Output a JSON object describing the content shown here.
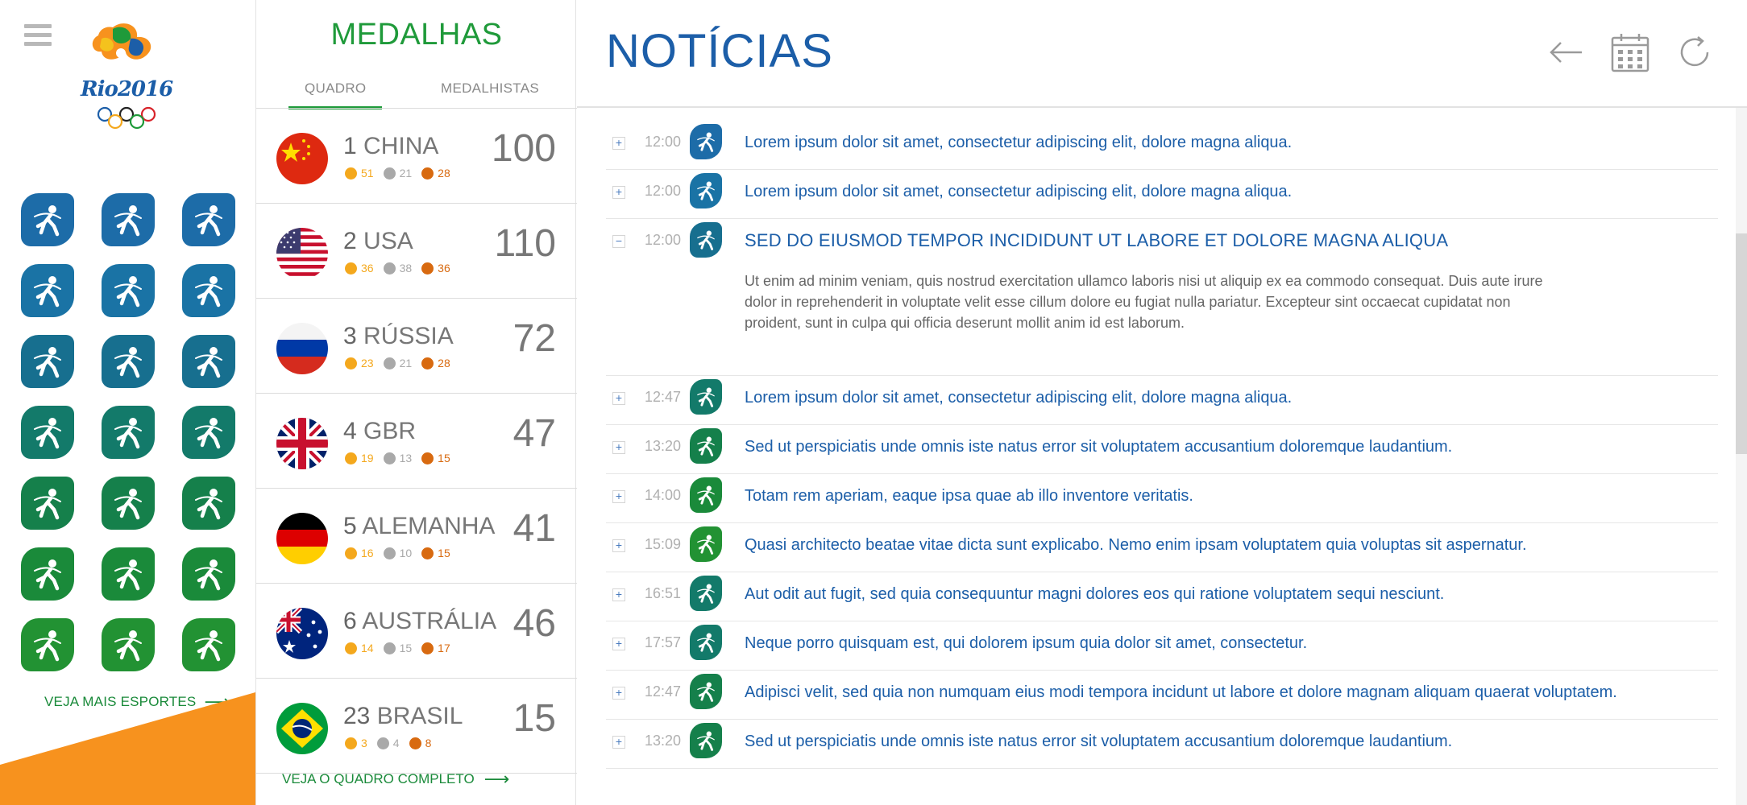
{
  "sidebar": {
    "logo_text": "Rio2016",
    "more_sports_label": "VEJA MAIS ESPORTES",
    "sports": [
      {
        "icon": "canoe-slalom-icon",
        "color": "#1d6ca8"
      },
      {
        "icon": "badminton-icon",
        "color": "#1d6ca8"
      },
      {
        "icon": "volleyball-icon",
        "color": "#1d6ca8"
      },
      {
        "icon": "cycling-mountain-bike-icon",
        "color": "#1a73a5"
      },
      {
        "icon": "cycling-road-icon",
        "color": "#1a73a5"
      },
      {
        "icon": "cycling-track-icon",
        "color": "#1a73a5"
      },
      {
        "icon": "swimming-icon",
        "color": "#176f8f"
      },
      {
        "icon": "water-polo-icon",
        "color": "#176f8f"
      },
      {
        "icon": "synchronized-swimming-icon",
        "color": "#176f8f"
      },
      {
        "icon": "rhythmic-gymnastics-icon",
        "color": "#137a6a"
      },
      {
        "icon": "trampoline-icon",
        "color": "#137a6a"
      },
      {
        "icon": "golf-icon",
        "color": "#137a6a"
      },
      {
        "icon": "hockey-icon",
        "color": "#15804b"
      },
      {
        "icon": "handball-icon",
        "color": "#15804b"
      },
      {
        "icon": "wheelchair-icon",
        "color": "#15804b"
      },
      {
        "icon": "rowing-icon",
        "color": "#1a8a3a"
      },
      {
        "icon": "rugby-icon",
        "color": "#1a8a3a"
      },
      {
        "icon": "taekwondo-icon",
        "color": "#1a8a3a"
      },
      {
        "icon": "fencing-icon",
        "color": "#229233"
      },
      {
        "icon": "football-icon",
        "color": "#229233"
      },
      {
        "icon": "sailing-icon",
        "color": "#229233"
      }
    ]
  },
  "medals": {
    "title": "MEDALHAS",
    "tabs": {
      "quadro": "QUADRO",
      "medalhistas": "MEDALHISTAS"
    },
    "full_table_label": "VEJA O QUADRO COMPLETO",
    "countries": [
      {
        "rank": "1",
        "name": "CHINA",
        "total": "100",
        "gold": "51",
        "silver": "21",
        "bronze": "28",
        "flag": "china"
      },
      {
        "rank": "2",
        "name": "USA",
        "total": "110",
        "gold": "36",
        "silver": "38",
        "bronze": "36",
        "flag": "usa"
      },
      {
        "rank": "3",
        "name": "RÚSSIA",
        "total": "72",
        "gold": "23",
        "silver": "21",
        "bronze": "28",
        "flag": "russia"
      },
      {
        "rank": "4",
        "name": "GBR",
        "total": "47",
        "gold": "19",
        "silver": "13",
        "bronze": "15",
        "flag": "uk"
      },
      {
        "rank": "5",
        "name": "ALEMANHA",
        "total": "41",
        "gold": "16",
        "silver": "10",
        "bronze": "15",
        "flag": "germany"
      },
      {
        "rank": "6",
        "name": "AUSTRÁLIA",
        "total": "46",
        "gold": "14",
        "silver": "15",
        "bronze": "17",
        "flag": "australia"
      },
      {
        "rank": "23",
        "name": "BRASIL",
        "total": "15",
        "gold": "3",
        "silver": "4",
        "bronze": "8",
        "flag": "brazil"
      }
    ]
  },
  "news": {
    "title": "NOTÍCIAS",
    "toolbar": {
      "back_icon": "arrow-left-icon",
      "calendar_icon": "calendar-icon",
      "refresh_icon": "refresh-icon"
    },
    "items": [
      {
        "toggle": "+",
        "time": "12:00",
        "icon_color": "#1d6ca8",
        "headline": "Lorem ipsum dolor sit amet, consectetur adipiscing elit, dolore magna aliqua."
      },
      {
        "toggle": "+",
        "time": "12:00",
        "icon_color": "#1a73a5",
        "headline": "Lorem ipsum dolor sit amet, consectetur adipiscing elit, dolore magna aliqua."
      },
      {
        "toggle": "−",
        "time": "12:00",
        "icon_color": "#176f8f",
        "headline": "SED DO EIUSMOD TEMPOR INCIDIDUNT UT LABORE ET DOLORE MAGNA ALIQUA",
        "body": "Ut enim ad minim veniam, quis nostrud exercitation ullamco laboris nisi ut aliquip ex ea commodo consequat. Duis aute irure dolor in reprehenderit in voluptate velit esse cillum dolore eu fugiat nulla pariatur. Excepteur sint occaecat cupidatat non proident, sunt in culpa qui officia deserunt mollit anim id est laborum."
      },
      {
        "toggle": "+",
        "time": "12:47",
        "icon_color": "#137a6a",
        "headline": "Lorem ipsum dolor sit amet, consectetur adipiscing elit, dolore magna aliqua."
      },
      {
        "toggle": "+",
        "time": "13:20",
        "icon_color": "#15804b",
        "headline": "Sed ut perspiciatis unde omnis iste natus error sit voluptatem accusantium doloremque laudantium."
      },
      {
        "toggle": "+",
        "time": "14:00",
        "icon_color": "#1a8a3a",
        "headline": "Totam rem aperiam, eaque ipsa quae ab illo inventore veritatis."
      },
      {
        "toggle": "+",
        "time": "15:09",
        "icon_color": "#229233",
        "headline": "Quasi architecto beatae vitae dicta sunt explicabo. Nemo enim ipsam voluptatem quia voluptas sit aspernatur."
      },
      {
        "toggle": "+",
        "time": "16:51",
        "icon_color": "#137a6a",
        "headline": "Aut odit aut fugit, sed quia consequuntur magni dolores eos qui ratione voluptatem sequi nesciunt."
      },
      {
        "toggle": "+",
        "time": "17:57",
        "icon_color": "#137a6a",
        "headline": "Neque porro quisquam est, qui dolorem ipsum quia dolor sit amet, consectetur."
      },
      {
        "toggle": "+",
        "time": "12:47",
        "icon_color": "#15804b",
        "headline": "Adipisci velit, sed quia non numquam eius modi tempora incidunt ut labore et dolore magnam aliquam quaerat voluptatem."
      },
      {
        "toggle": "+",
        "time": "13:20",
        "icon_color": "#15804b",
        "headline": "Sed ut perspiciatis unde omnis iste natus error sit voluptatem accusantium doloremque laudantium."
      }
    ]
  },
  "colors": {
    "green": "#1f9a3a",
    "blue": "#1c5ea8",
    "orange": "#f7921e",
    "gold": "#f4a81d",
    "silver": "#a9a9a9",
    "bronze": "#d86a10"
  }
}
